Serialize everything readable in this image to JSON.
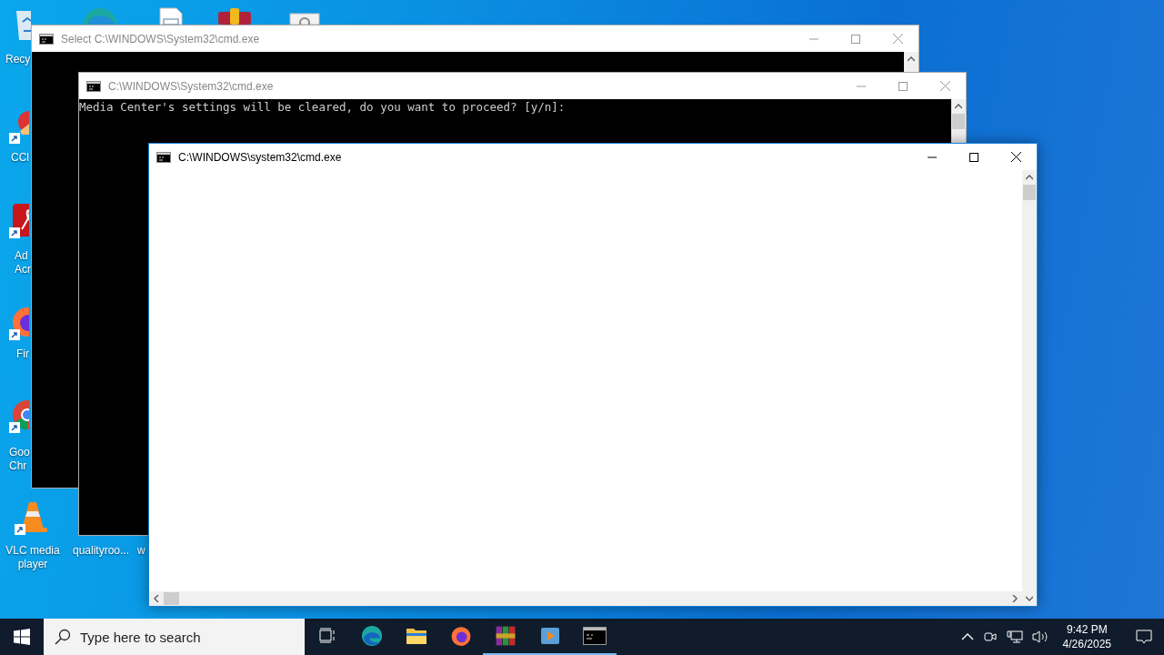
{
  "desktop_icons": [
    {
      "kind": "recycle",
      "lines": [
        "Recy"
      ]
    },
    {
      "kind": "ccleaner",
      "lines": [
        "CCl"
      ]
    },
    {
      "kind": "acrobat",
      "lines": [
        "Ad",
        "Acr"
      ]
    },
    {
      "kind": "firefox",
      "lines": [
        "Fir"
      ]
    },
    {
      "kind": "chrome",
      "lines": [
        "Goo",
        "Chr"
      ]
    },
    {
      "kind": "vlc",
      "lines": [
        "VLC media",
        "player"
      ]
    },
    {
      "kind": "file",
      "lines": [
        "qualityroo..."
      ]
    },
    {
      "kind": "blank",
      "lines": [
        "w"
      ]
    },
    {
      "kind": "edge"
    },
    {
      "kind": "document"
    },
    {
      "kind": "archive"
    },
    {
      "kind": "settings"
    }
  ],
  "windows": [
    {
      "title": "Select C:\\WINDOWS\\System32\\cmd.exe",
      "active": false,
      "kind": "dark"
    },
    {
      "title": "C:\\WINDOWS\\System32\\cmd.exe",
      "active": false,
      "kind": "dark",
      "lines": [
        "Media Center's settings will be cleared, do you want to proceed? [y/n]:"
      ]
    },
    {
      "title": "C:\\WINDOWS\\system32\\cmd.exe",
      "active": true,
      "kind": "light"
    }
  ],
  "taskbar": {
    "search": {
      "placeholder": "Type here to search"
    },
    "apps": [
      {
        "kind": "taskview",
        "running": false
      },
      {
        "kind": "edge",
        "running": false
      },
      {
        "kind": "explorer",
        "running": false
      },
      {
        "kind": "firefox",
        "running": false
      },
      {
        "kind": "archive",
        "running": true
      },
      {
        "kind": "player",
        "running": true
      },
      {
        "kind": "console",
        "running": true
      }
    ],
    "time": "9:42 PM",
    "date": "4/26/2025"
  }
}
